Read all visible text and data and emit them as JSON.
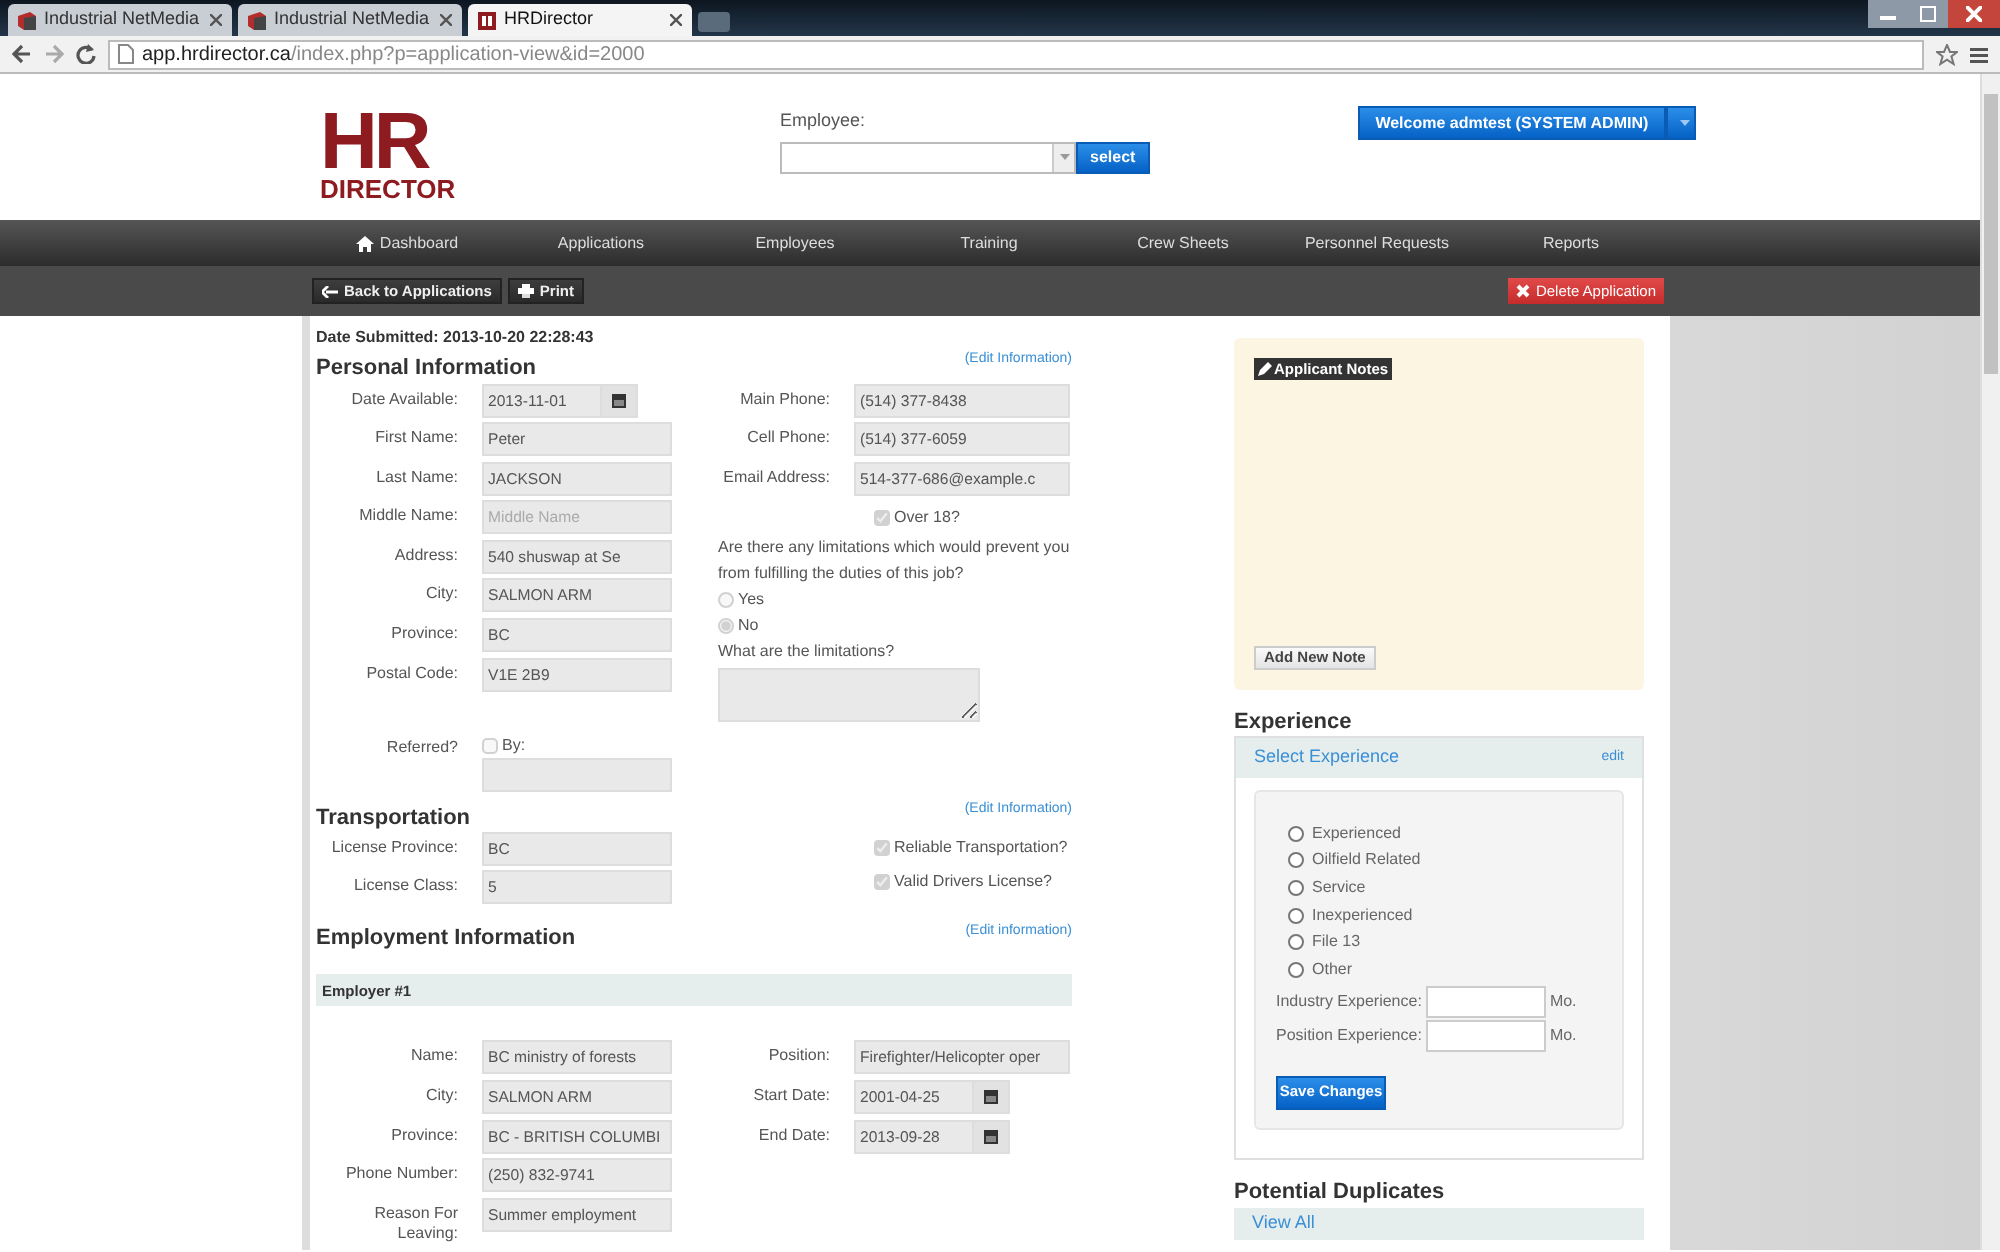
{
  "browser": {
    "tabs": [
      {
        "title": "Industrial NetMedia",
        "selected": false
      },
      {
        "title": "Industrial NetMedia",
        "selected": false
      },
      {
        "title": "HRDirector",
        "selected": true
      }
    ],
    "url_host": "app.hrdirector.ca",
    "url_path": "/index.php?p=application-view&id=2000"
  },
  "header": {
    "logo_mark": "HR",
    "logo_text": "DIRECTOR",
    "employee_label": "Employee:",
    "select_button": "select",
    "welcome": "Welcome admtest (SYSTEM ADMIN)"
  },
  "nav": [
    {
      "label": "Dashboard",
      "kind": "home"
    },
    {
      "label": "Applications",
      "kind": "plain"
    },
    {
      "label": "Employees",
      "kind": "plain"
    },
    {
      "label": "Training",
      "kind": "plain"
    },
    {
      "label": "Crew Sheets",
      "kind": "plain"
    },
    {
      "label": "Personnel Requests",
      "kind": "plain"
    },
    {
      "label": "Reports",
      "kind": "plain"
    }
  ],
  "toolbar": {
    "back": "Back to Applications",
    "print": "Print",
    "delete": "Delete Application"
  },
  "date_submitted": "Date Submitted: 2013-10-20 22:28:43",
  "personal": {
    "title": "Personal Information",
    "edit": "(Edit Information)",
    "left_fields": [
      {
        "label": "Date Available:",
        "value": "2013-11-01",
        "kind": "date"
      },
      {
        "label": "First Name:",
        "value": "Peter"
      },
      {
        "label": "Last Name:",
        "value": "JACKSON"
      },
      {
        "label": "Middle Name:",
        "placeholder": "Middle Name"
      },
      {
        "label": "Address:",
        "value": "540 shuswap at Se"
      },
      {
        "label": "City:",
        "value": "SALMON ARM"
      },
      {
        "label": "Province:",
        "value": "BC"
      },
      {
        "label": "Postal Code:",
        "value": "V1E 2B9"
      }
    ],
    "right_fields": [
      {
        "label": "Main Phone:",
        "value": "(514) 377-8438"
      },
      {
        "label": "Cell Phone:",
        "value": "(514) 377-6059"
      },
      {
        "label": "Email Address:",
        "value": "514-377-686@example.c"
      }
    ],
    "over18": {
      "label": "Over 18?",
      "checked": true
    },
    "question": "Are there any limitations which would prevent you from fulfilling the duties of this job?",
    "options": [
      {
        "label": "Yes",
        "selected": false
      },
      {
        "label": "No",
        "selected": true
      }
    ],
    "limitations_label": "What are the limitations?",
    "referred": {
      "label": "Referred?",
      "by_label": "By:",
      "checked": false
    }
  },
  "transportation": {
    "title": "Transportation",
    "edit": "(Edit Information)",
    "fields": [
      {
        "label": "License Province:",
        "value": "BC"
      },
      {
        "label": "License Class:",
        "value": "5"
      }
    ],
    "checks": [
      {
        "label": "Reliable Transportation?",
        "checked": true
      },
      {
        "label": "Valid Drivers License?",
        "checked": true
      }
    ]
  },
  "employment": {
    "title": "Employment Information",
    "edit": "(Edit information)",
    "employer": "Employer #1",
    "left_fields": [
      {
        "label": "Name:",
        "value": "BC ministry of forests"
      },
      {
        "label": "City:",
        "value": "SALMON ARM"
      },
      {
        "label": "Province:",
        "value": "BC - BRITISH COLUMBI"
      },
      {
        "label": "Phone Number:",
        "value": "(250) 832-9741"
      },
      {
        "label": "Reason For Leaving:",
        "value": "Summer employment"
      }
    ],
    "right_fields": [
      {
        "label": "Position:",
        "value": "Firefighter/Helicopter oper"
      },
      {
        "label": "Start Date:",
        "value": "2001-04-25",
        "kind": "date"
      },
      {
        "label": "End Date:",
        "value": "2013-09-28",
        "kind": "date"
      }
    ]
  },
  "notes": {
    "label": "Applicant Notes",
    "add_button": "Add New Note"
  },
  "experience": {
    "title": "Experience",
    "panel_title": "Select Experience",
    "edit": "edit",
    "options": [
      {
        "label": "Experienced",
        "selected": false
      },
      {
        "label": "Oilfield Related",
        "selected": false
      },
      {
        "label": "Service",
        "selected": false
      },
      {
        "label": "Inexperienced",
        "selected": false
      },
      {
        "label": "File 13",
        "selected": false
      },
      {
        "label": "Other",
        "selected": false
      }
    ],
    "durations": [
      {
        "label": "Industry Experience:",
        "unit": "Mo."
      },
      {
        "label": "Position Experience:",
        "unit": "Mo."
      }
    ],
    "save_button": "Save Changes"
  },
  "duplicates": {
    "title": "Potential Duplicates",
    "link": "View All"
  }
}
